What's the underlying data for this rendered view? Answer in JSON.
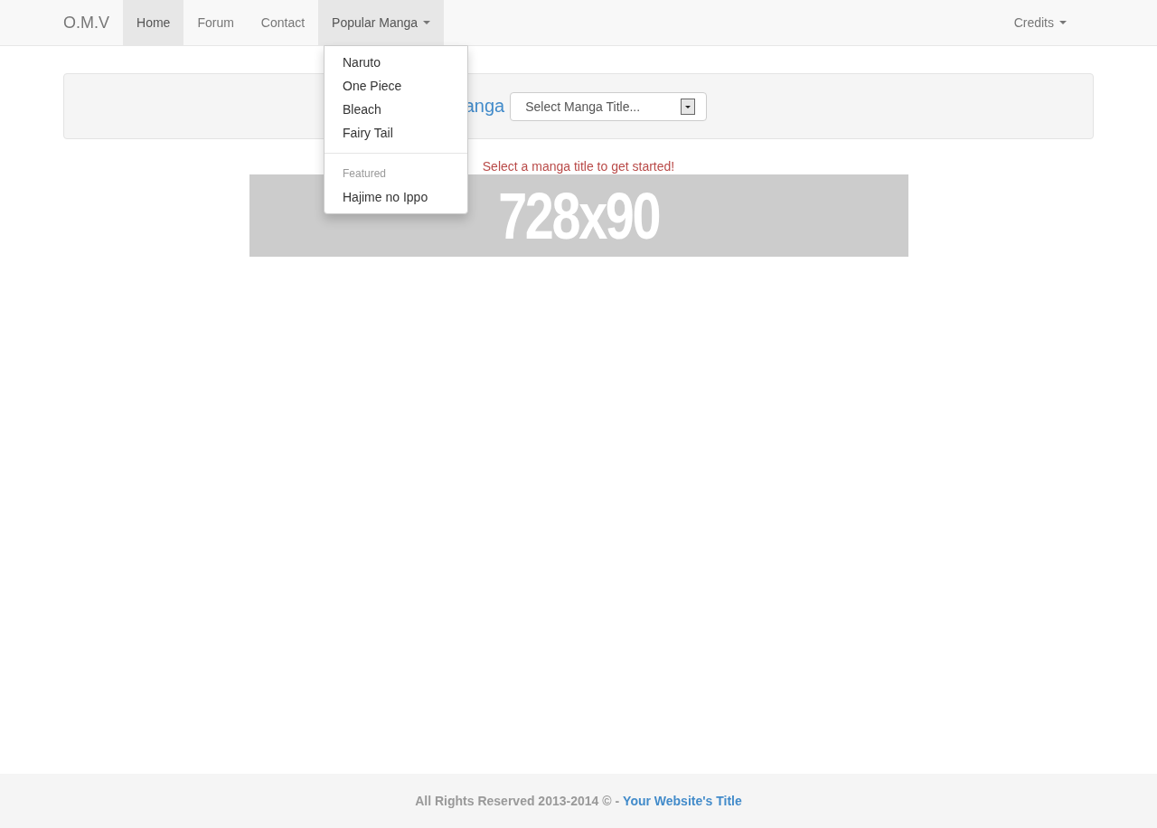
{
  "navbar": {
    "brand": "O.M.V",
    "items": [
      {
        "label": "Home",
        "selected": true,
        "kind": "link"
      },
      {
        "label": "Forum",
        "selected": false,
        "kind": "link"
      },
      {
        "label": "Contact",
        "selected": false,
        "kind": "link"
      },
      {
        "label": "Popular Manga",
        "kind": "dropdown",
        "expanded": true
      }
    ],
    "right_items": [
      {
        "label": "Credits",
        "kind": "dropdown",
        "expanded": false
      }
    ]
  },
  "dropdown_menu": [
    {
      "kind": "item",
      "label": "Naruto"
    },
    {
      "kind": "item",
      "label": "One Piece"
    },
    {
      "kind": "item",
      "label": "Bleach"
    },
    {
      "kind": "item",
      "label": "Fairy Tail"
    },
    {
      "kind": "divider"
    },
    {
      "kind": "header",
      "label": "Featured"
    },
    {
      "kind": "item",
      "label": "Hajime no Ippo"
    }
  ],
  "panel": {
    "heading": "anga",
    "select": {
      "placeholder": "Select Manga Title..."
    }
  },
  "message": "Select a manga title to get started!",
  "ad_banner": {
    "text": "728x90"
  },
  "footer": {
    "text": "All Rights Reserved 2013-2014 © -",
    "link": "Your Website's Title"
  }
}
